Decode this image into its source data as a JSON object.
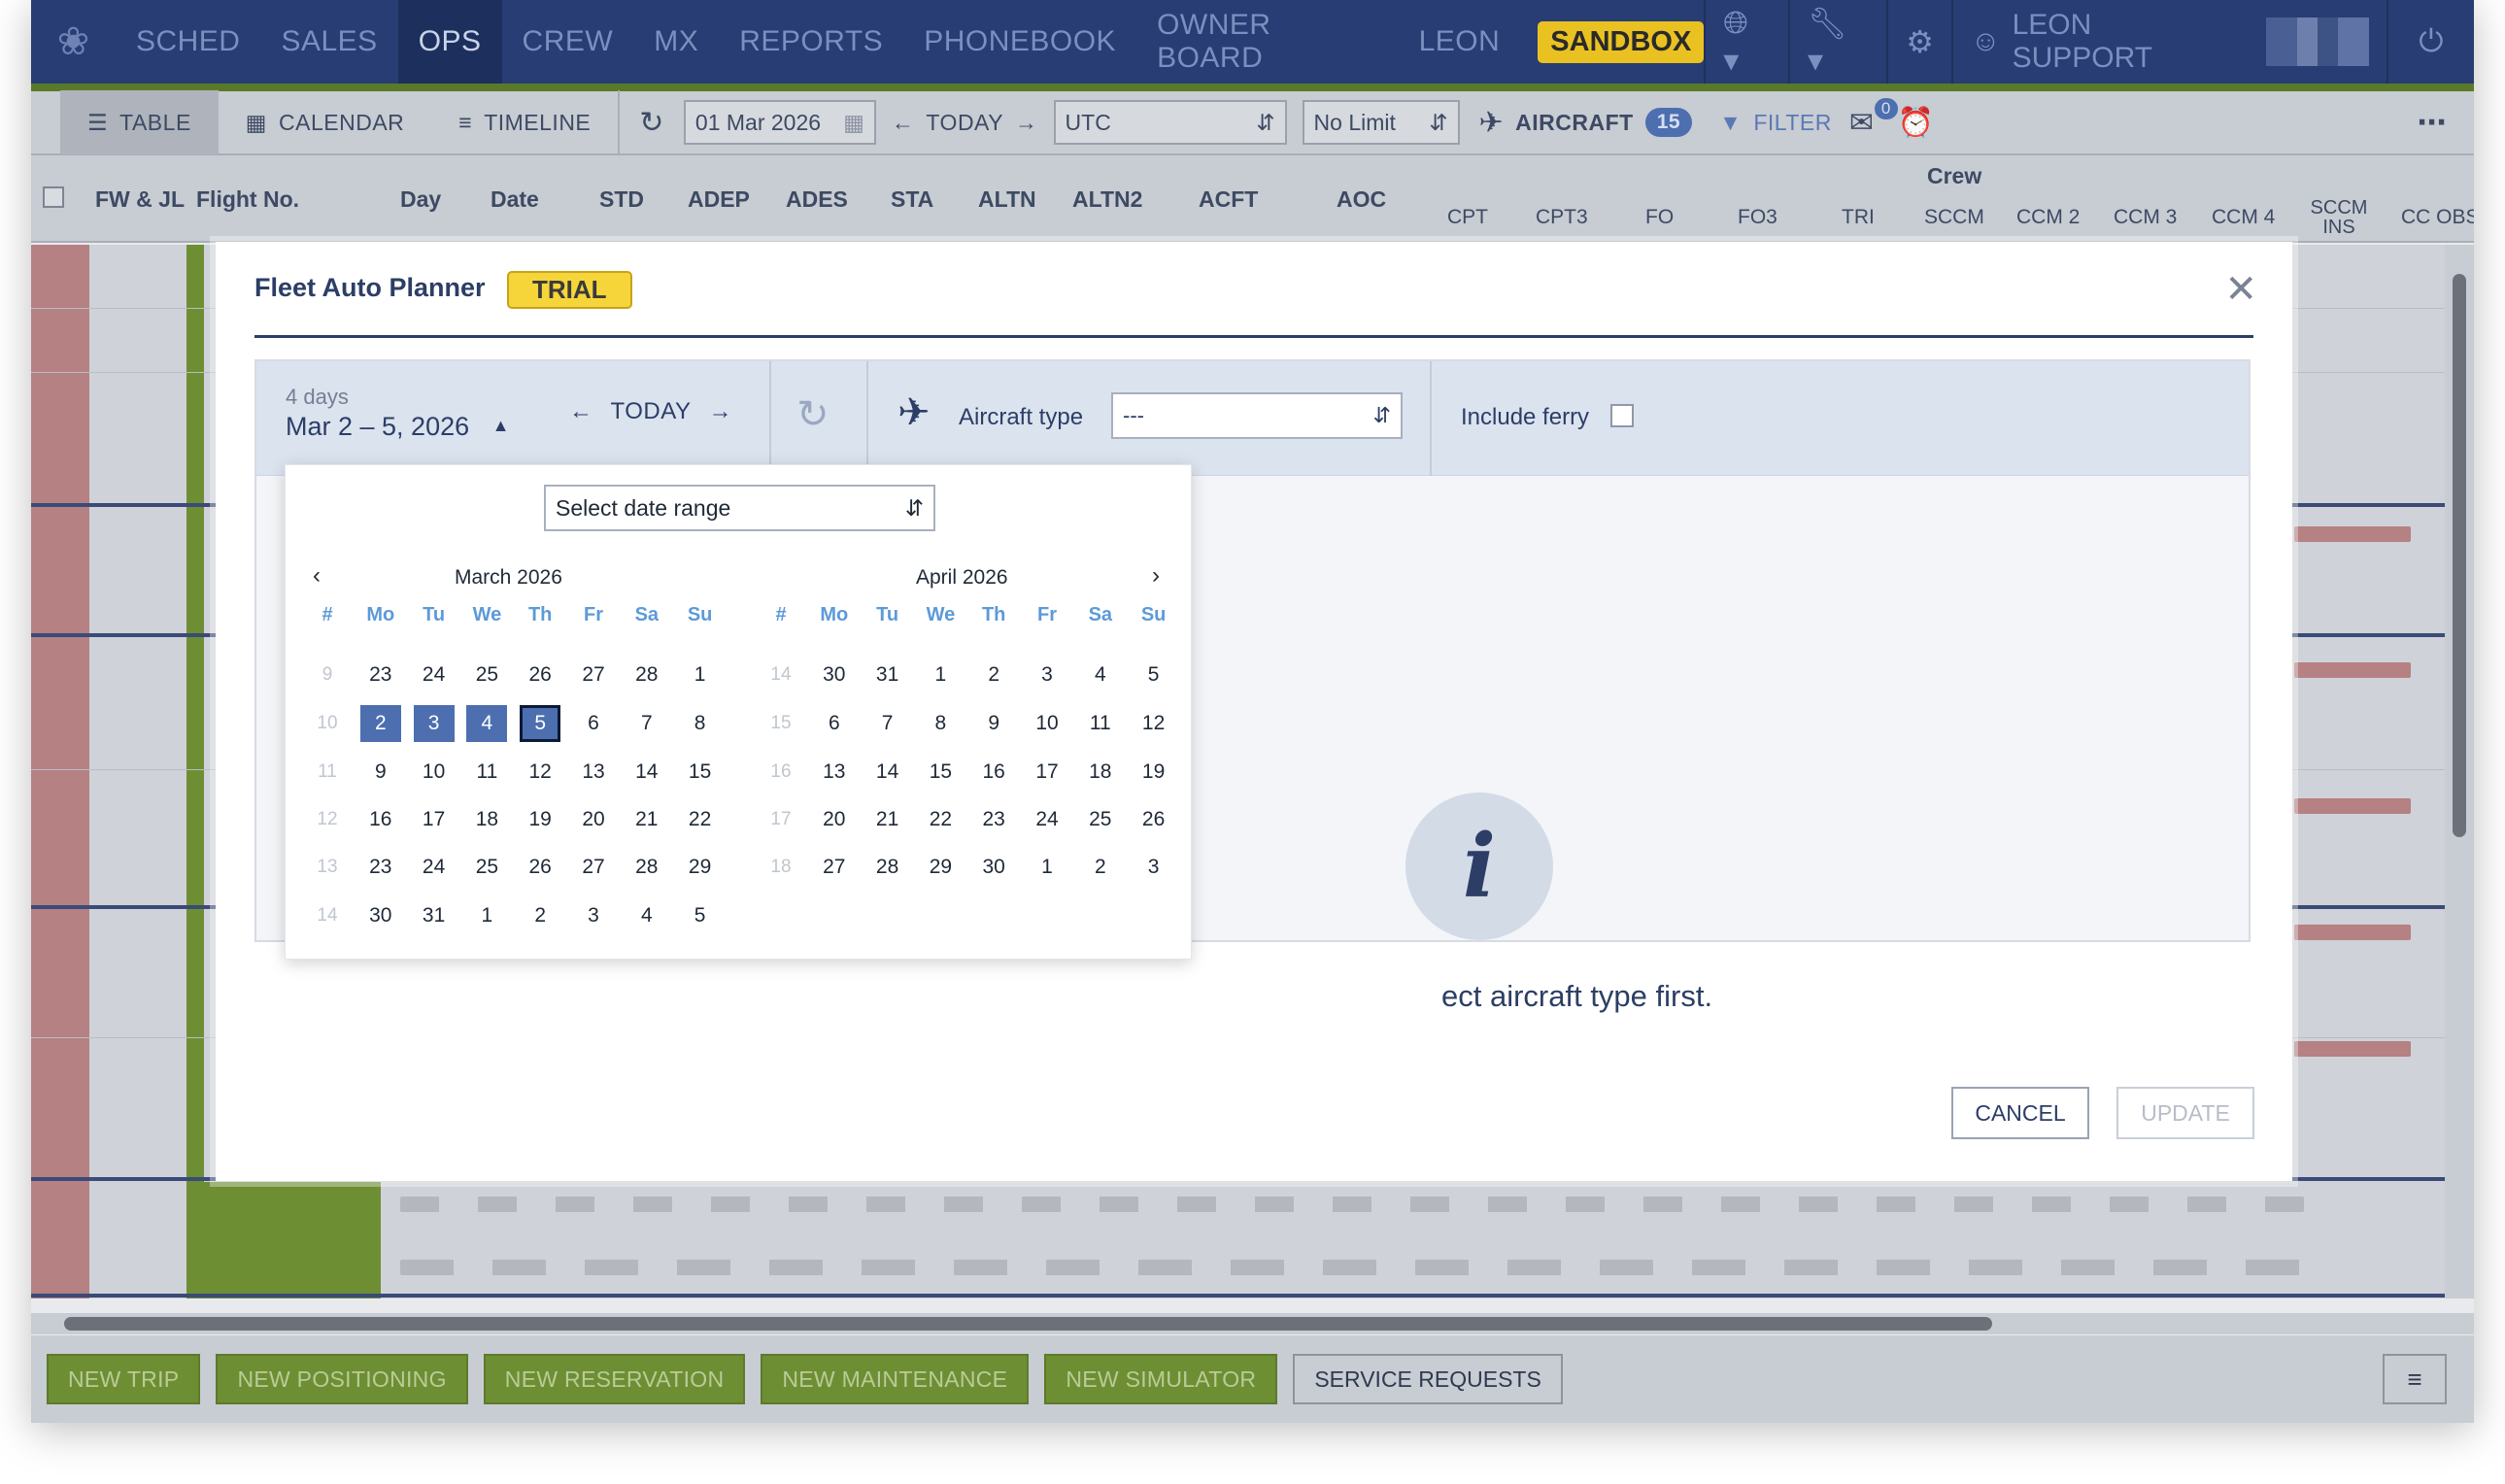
{
  "topnav": {
    "items": [
      "SCHED",
      "SALES",
      "OPS",
      "CREW",
      "MX",
      "REPORTS",
      "PHONEBOOK",
      "OWNER BOARD",
      "LEON"
    ],
    "active": "OPS",
    "sandbox": "SANDBOX",
    "user": "LEON SUPPORT"
  },
  "toolbar": {
    "table": "TABLE",
    "calendar": "CALENDAR",
    "timeline": "TIMELINE",
    "date": "01 Mar 2026",
    "today": "TODAY",
    "timezone": "UTC",
    "limit": "No Limit",
    "aircraft": "AIRCRAFT",
    "aircraft_count": "15",
    "filter": "FILTER",
    "mail_count": "0"
  },
  "columns": {
    "fwjl": "FW & JL",
    "flight_no": "Flight No.",
    "day": "Day",
    "date": "Date",
    "std": "STD",
    "adep": "ADEP",
    "ades": "ADES",
    "sta": "STA",
    "altn": "ALTN",
    "altn2": "ALTN2",
    "acft": "ACFT",
    "aoc": "AOC",
    "crew_group": "Crew",
    "cpt": "CPT",
    "cpt3": "CPT3",
    "fo": "FO",
    "fo3": "FO3",
    "tri": "TRI",
    "sccm": "SCCM",
    "ccm2": "CCM 2",
    "ccm3": "CCM 3",
    "ccm4": "CCM 4",
    "sccm_ins": "SCCM INS",
    "cc_obs": "CC OBS"
  },
  "modal": {
    "title": "Fleet Auto Planner",
    "badge": "TRIAL",
    "days_label": "4 days",
    "date_range": "Mar 2 – 5, 2026",
    "today": "TODAY",
    "aircraft_type_label": "Aircraft type",
    "aircraft_type_value": "---",
    "include_ferry": "Include ferry",
    "message": "ect aircraft type first.",
    "cancel": "CANCEL",
    "update": "UPDATE"
  },
  "calendar": {
    "range_select": "Select date range",
    "weekday_header": [
      "#",
      "Mo",
      "Tu",
      "We",
      "Th",
      "Fr",
      "Sa",
      "Su"
    ],
    "months": [
      {
        "title": "March 2026",
        "weeks": [
          [
            "9",
            "23",
            "24",
            "25",
            "26",
            "27",
            "28",
            "1"
          ],
          [
            "10",
            "2",
            "3",
            "4",
            "5",
            "6",
            "7",
            "8"
          ],
          [
            "11",
            "9",
            "10",
            "11",
            "12",
            "13",
            "14",
            "15"
          ],
          [
            "12",
            "16",
            "17",
            "18",
            "19",
            "20",
            "21",
            "22"
          ],
          [
            "13",
            "23",
            "24",
            "25",
            "26",
            "27",
            "28",
            "29"
          ],
          [
            "14",
            "30",
            "31",
            "1",
            "2",
            "3",
            "4",
            "5"
          ]
        ]
      },
      {
        "title": "April 2026",
        "weeks": [
          [
            "14",
            "30",
            "31",
            "1",
            "2",
            "3",
            "4",
            "5"
          ],
          [
            "15",
            "6",
            "7",
            "8",
            "9",
            "10",
            "11",
            "12"
          ],
          [
            "16",
            "13",
            "14",
            "15",
            "16",
            "17",
            "18",
            "19"
          ],
          [
            "17",
            "20",
            "21",
            "22",
            "23",
            "24",
            "25",
            "26"
          ],
          [
            "18",
            "27",
            "28",
            "29",
            "30",
            "1",
            "2",
            "3"
          ]
        ]
      }
    ],
    "selected_range": [
      "2",
      "3",
      "4",
      "5"
    ]
  },
  "bottom": {
    "buttons": [
      "NEW TRIP",
      "NEW POSITIONING",
      "NEW RESERVATION",
      "NEW MAINTENANCE",
      "NEW SIMULATOR"
    ],
    "service": "SERVICE REQUESTS"
  },
  "colors": {
    "nav_bg": "#273d73",
    "accent": "#4d6fb0",
    "trial": "#f5d53a",
    "sandbox": "#e9c222",
    "green": "#6e8e33"
  }
}
